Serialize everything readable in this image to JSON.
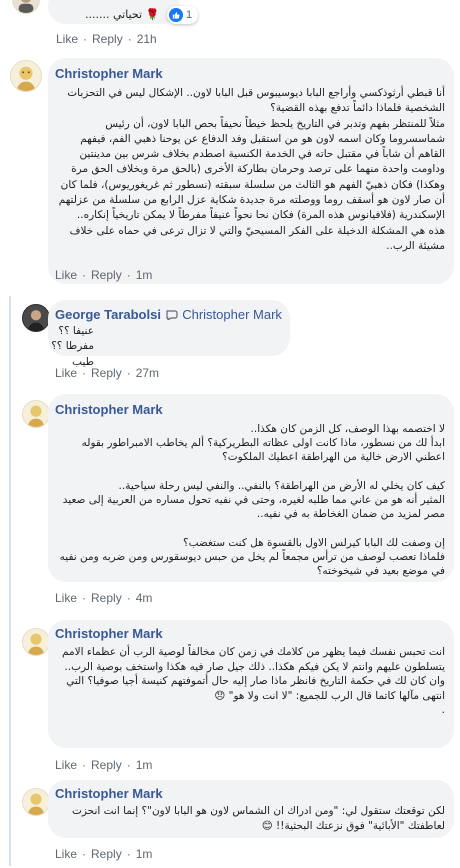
{
  "top_comment": {
    "text": "تحياتي .......",
    "rose_emoji": "🌹",
    "reaction_count": "1",
    "like_label": "Like",
    "reply_label": "Reply",
    "time": "21h"
  },
  "comments": [
    {
      "author": "Christopher Mark",
      "text": "أنا قبطي أرثوذكسي وأراجع البابا ديوسيبوس قبل البابا لاون.. الإشكال ليس في التحزبات الشخصية فلماذا دائماً تدفع بهذه القضية؟\nمثلاً للمنتظر بفهم وتدبر في التاريخ يلحظ خيطاً نحيفاً بحص البابا لاون، أن رئيس شماسسروما وكان اسمه لاون هو من استقبل وفد الدفاع عن يوحنا ذهبي الفم، فيفهم القاهم أن شاباً في مقتبل حاته في الخدمة الكنسية اصطدم بخلاف شرس بين مدينتين وداومت واحدة منهما على ترصد وحرمان بطاركة الأخرى (بالحق مرة وبخلاف الحق مرة وهكذا) فكان ذهبيّ الفهم هو الثالث من سلسلة سبقته (نسطور ثم غريغوريوس)، فلما كان أن صار لاون هو أسقف روما ووصلته مرة جديدة شكاية عزل الرابع من سلسلة من عزلتهم الإسكندرية (فلافيانوس هذه المرة) فكان نحا نحواً عنيفاً مفرطاً لا يمكن تاريخياً إنكاره..\nهذه هي المشكلة الدخيلة على الفكر المسيحيّ والتي لا تزال ترعى في حماه على خلاف مشيئة الرب..",
      "like_label": "Like",
      "reply_label": "Reply",
      "time": "1m"
    },
    {
      "author": "George Tarabolsi",
      "mention": "Christopher Mark",
      "text": "عنيفا ؟؟ مفرطا ؟؟\nطيب",
      "like_label": "Like",
      "reply_label": "Reply",
      "time": "27m"
    },
    {
      "author": "Christopher Mark",
      "text": "لا اختصمه بهذا الوصف، كل الزمن كان هكذا..\nابدأ لك من نسطور، ماذا كانت اولى عظاته البطريركية؟ ألم يخاطب الامبراطور بقوله اعطني الارض خالية من الهراطقة اعطيك الملكوت؟\n\nكيف كان يخلي له الأرض من الهراطقة؟ بالنفي.. والنفي ليس رحلة سياحية..\nالمثير أنه هو من عاني مما طلبه لغيره، وحتى في نفيه تحول مساره من العربية إلى صعيد مصر لمزيد من ضمان الغخاطة به في نفيه..\n\nإن وصفت لك البابا كيرلس الاول بالقسوة هل كنت ستغضب؟\nفلماذا تعصب لوصف من ترأس مجمعاً لم يخل من حبس ديوسقورس ومن ضربه ومن نفيه في موضع بعيد في شيخوخته؟",
      "like_label": "Like",
      "reply_label": "Reply",
      "time": "4m"
    },
    {
      "author": "Christopher Mark",
      "text": "انت تحبس نفسك فيما يظهر من كلامك في زمن كان مخالفاً لوصية الرب أن عظماء الامم يتسلطون عليهم وانتم لا يكن فيكم هكذا.. ذلك جيل صار فيه هكذا واستخف بوصية الرب..\nوان كان لك في حكمة التاريخ فانظر ماذا صار إليه حال أتموفتهم كنيسة أجيا صوفيا؟ التي انتهى مآلها كاتما قال الرب للجميع: \"لا انت ولا هو\" 😞\n.",
      "like_label": "Like",
      "reply_label": "Reply",
      "time": "1m"
    },
    {
      "author": "Christopher Mark",
      "text": "لكن توقعتك ستقول لي: \"ومن ادراك ان الشماس لاون هو البابا لاون\"؟ إنما انت انحزت لعاطفتك \"الأبائية\" فوق نزعتك البحثية!! 😊",
      "like_label": "Like",
      "reply_label": "Reply",
      "time": "1m"
    }
  ]
}
